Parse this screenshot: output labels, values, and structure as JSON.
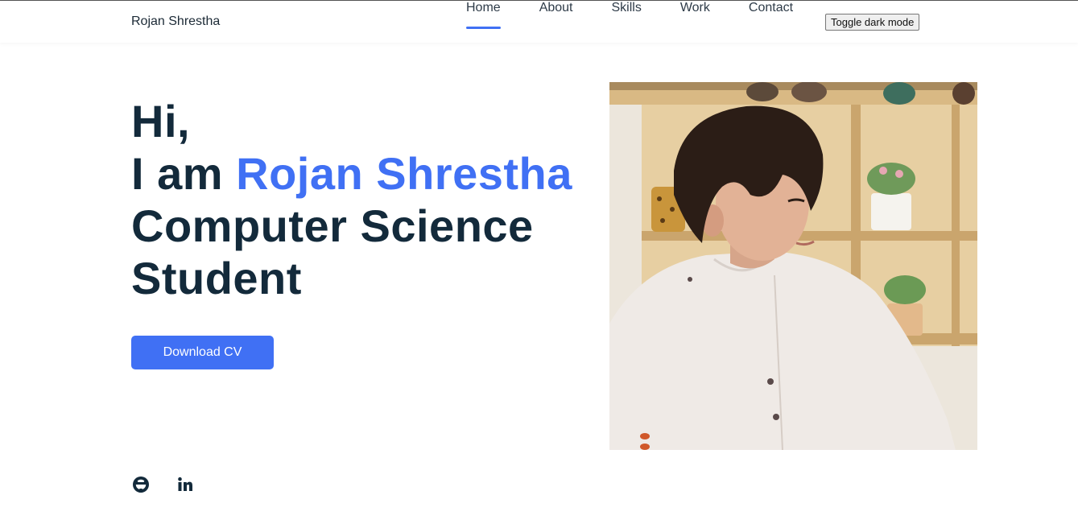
{
  "header": {
    "logo": "Rojan Shrestha",
    "nav": [
      "Home",
      "About",
      "Skills",
      "Work",
      "Contact"
    ],
    "active_nav": "Home",
    "toggle_label": "Toggle dark mode"
  },
  "hero": {
    "line1": "Hi,",
    "line2_prefix": "I am ",
    "line2_name": "Rojan Shrestha",
    "line3": "Computer Science",
    "line4": "Student",
    "cta": "Download CV"
  },
  "social": [
    "github-icon",
    "linkedin-icon"
  ],
  "colors": {
    "accent": "#4070f4",
    "text": "#132a3b"
  }
}
